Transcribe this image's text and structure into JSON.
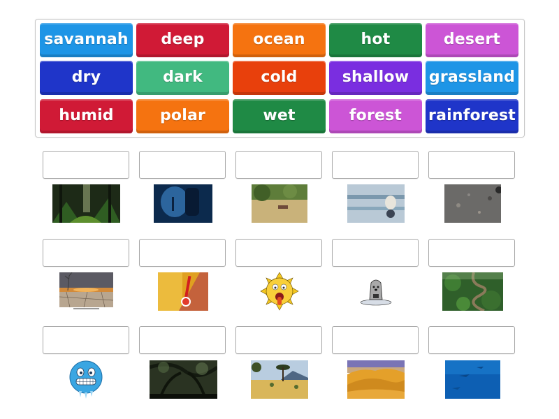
{
  "word_bank": {
    "tiles": [
      {
        "label": "savannah",
        "color": "#1e95e6"
      },
      {
        "label": "deep",
        "color": "#d01a36"
      },
      {
        "label": "ocean",
        "color": "#f57310"
      },
      {
        "label": "hot",
        "color": "#1f8a45"
      },
      {
        "label": "desert",
        "color": "#cc55d6"
      },
      {
        "label": "dry",
        "color": "#1f35c9"
      },
      {
        "label": "dark",
        "color": "#41b980"
      },
      {
        "label": "cold",
        "color": "#e8400c"
      },
      {
        "label": "shallow",
        "color": "#7a2ee0"
      },
      {
        "label": "grassland",
        "color": "#1e95e6"
      },
      {
        "label": "humid",
        "color": "#d01a36"
      },
      {
        "label": "polar",
        "color": "#f57310"
      },
      {
        "label": "wet",
        "color": "#1f8a45"
      },
      {
        "label": "forest",
        "color": "#cc55d6"
      },
      {
        "label": "rainforest",
        "color": "#1f35c9"
      }
    ]
  },
  "targets": [
    {
      "image": "dark-forest-path-photo"
    },
    {
      "image": "deep-underwater-diver-photo"
    },
    {
      "image": "savannah-grassland-photo"
    },
    {
      "image": "polar-bear-on-ice-photo"
    },
    {
      "image": "shallow-water-pebbles-photo"
    },
    {
      "image": "dry-cracked-earth-photo"
    },
    {
      "image": "hot-thermometer-photo"
    },
    {
      "image": "hot-sweating-sun-cartoon"
    },
    {
      "image": "wet-dog-cartoon"
    },
    {
      "image": "rainforest-river-aerial-photo"
    },
    {
      "image": "freezing-cold-emoji"
    },
    {
      "image": "humid-forest-canopy-photo"
    },
    {
      "image": "savannah-acacia-photo"
    },
    {
      "image": "desert-sand-dunes-photo"
    },
    {
      "image": "ocean-sharks-photo"
    }
  ]
}
